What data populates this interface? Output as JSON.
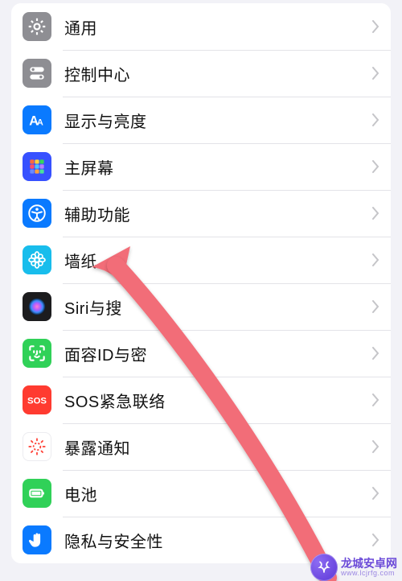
{
  "settings": {
    "items": [
      {
        "key": "general",
        "label": "通用",
        "icon": "gear-icon",
        "bg": "#8e8e93",
        "fg": "#ffffff"
      },
      {
        "key": "control-center",
        "label": "控制中心",
        "icon": "switches-icon",
        "bg": "#8e8e93",
        "fg": "#ffffff"
      },
      {
        "key": "display",
        "label": "显示与亮度",
        "icon": "text-size-icon",
        "bg": "#0a7aff",
        "fg": "#ffffff"
      },
      {
        "key": "home-screen",
        "label": "主屏幕",
        "icon": "grid-icon",
        "bg": "#3751ff",
        "fg": "#ffffff"
      },
      {
        "key": "accessibility",
        "label": "辅助功能",
        "icon": "accessibility-icon",
        "bg": "#0a7aff",
        "fg": "#ffffff"
      },
      {
        "key": "wallpaper",
        "label": "墙纸",
        "icon": "flower-icon",
        "bg": "#18bdec",
        "fg": "#ffffff"
      },
      {
        "key": "siri",
        "label": "Siri与搜",
        "icon": "siri-icon",
        "bg": "#1c1c1e",
        "fg": "#ffffff"
      },
      {
        "key": "faceid",
        "label": "面容ID与密",
        "icon": "faceid-icon",
        "bg": "#30d158",
        "fg": "#ffffff"
      },
      {
        "key": "sos",
        "label": "SOS紧急联络",
        "icon": "sos-icon",
        "bg": "#ff3b30",
        "fg": "#ffffff"
      },
      {
        "key": "exposure",
        "label": "暴露通知",
        "icon": "exposure-icon",
        "bg": "#ffffff",
        "fg": "#ff3b30"
      },
      {
        "key": "battery",
        "label": "电池",
        "icon": "battery-icon",
        "bg": "#30d158",
        "fg": "#ffffff"
      },
      {
        "key": "privacy",
        "label": "隐私与安全性",
        "icon": "hand-icon",
        "bg": "#0a7aff",
        "fg": "#ffffff"
      }
    ]
  },
  "annotation": {
    "arrow_color": "#f26d78",
    "target_index": 5
  },
  "watermark": {
    "line1": "龙城安卓网",
    "line2": "www.lcjrfg.com"
  }
}
